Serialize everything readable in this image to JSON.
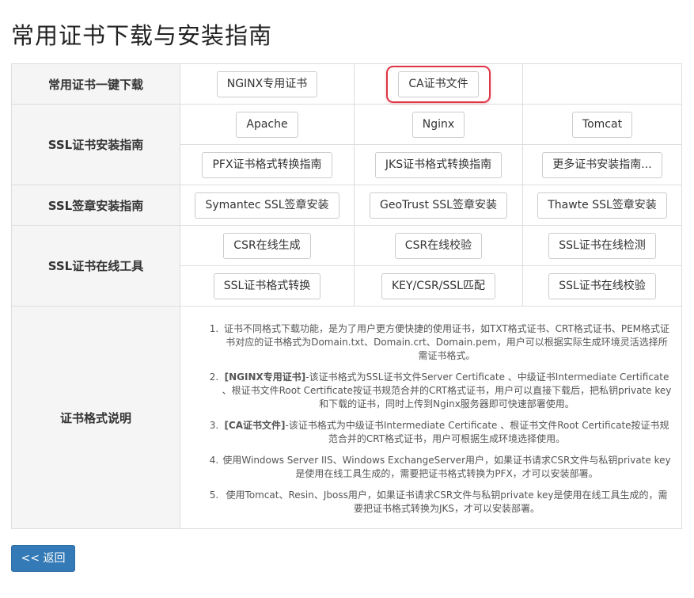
{
  "page": {
    "title": "常用证书下载与安装指南"
  },
  "download": {
    "label": "常用证书一键下载",
    "nginx_cert": "NGINX专用证书",
    "ca_cert": "CA证书文件"
  },
  "install": {
    "label": "SSL证书安装指南",
    "apache": "Apache",
    "nginx": "Nginx",
    "tomcat": "Tomcat",
    "pfx_guide": "PFX证书格式转换指南",
    "jks_guide": "JKS证书格式转换指南",
    "more_guide": "更多证书安装指南..."
  },
  "seal": {
    "label": "SSL签章安装指南",
    "symantec": "Symantec SSL签章安装",
    "geotrust": "GeoTrust SSL签章安装",
    "thawte": "Thawte SSL签章安装"
  },
  "tools": {
    "label": "SSL证书在线工具",
    "csr_generate": "CSR在线生成",
    "csr_verify": "CSR在线校验",
    "cert_check": "SSL证书在线检测",
    "format_convert": "SSL证书格式转换",
    "key_match": "KEY/CSR/SSL匹配",
    "cert_verify": "SSL证书在线校验"
  },
  "format_desc": {
    "label": "证书格式说明",
    "items": [
      {
        "prefix": "",
        "text": "证书不同格式下载功能，是为了用户更方便快捷的使用证书，如TXT格式证书、CRT格式证书、PEM格式证书对应的证书格式为Domain.txt、Domain.crt、Domain.pem，用户可以根据实际生成环境灵活选择所需证书格式。"
      },
      {
        "prefix": "[NGINX专用证书]",
        "text": "-该证书格式为SSL证书文件Server Certificate 、中级证书Intermediate Certificate 、根证书文件Root Certificate按证书规范合并的CRT格式证书，用户可以直接下载后，把私钥private key和下载的证书，同时上传到Nginx服务器即可快速部署使用。"
      },
      {
        "prefix": "[CA证书文件]",
        "text": "-该证书格式为中级证书Intermediate Certificate 、根证书文件Root Certificate按证书规范合并的CRT格式证书，用户可根据生成环境选择使用。"
      },
      {
        "prefix": "",
        "text": "使用Windows Server IIS、Windows ExchangeServer用户，如果证书请求CSR文件与私钥private key是使用在线工具生成的，需要把证书格式转换为PFX，才可以安装部署。"
      },
      {
        "prefix": "",
        "text": "使用Tomcat、Resin、Jboss用户，如果证书请求CSR文件与私钥private key是使用在线工具生成的，需要把证书格式转换为JKS，才可以安装部署。"
      }
    ]
  },
  "back_button": "<< 返回"
}
